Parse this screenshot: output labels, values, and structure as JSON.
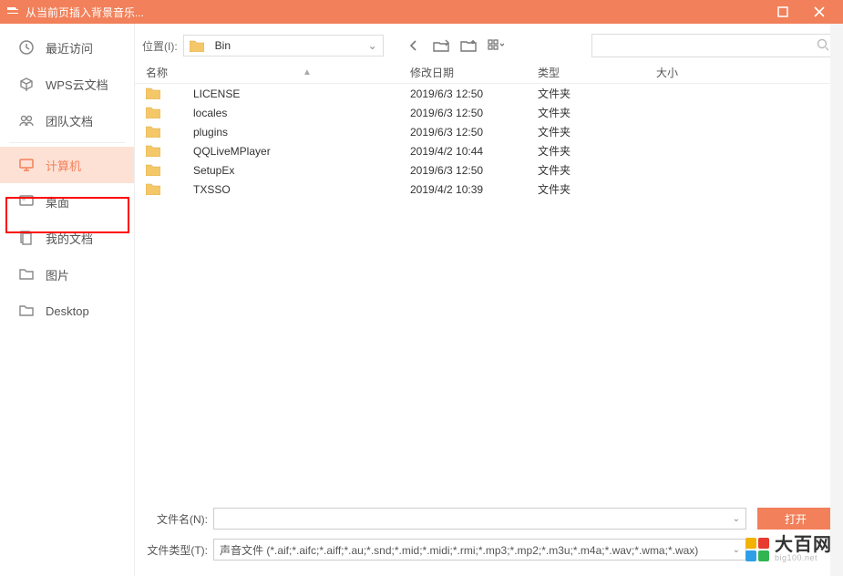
{
  "titlebar": {
    "title": "从当前页插入背景音乐..."
  },
  "sidebar": {
    "items": [
      {
        "label": "最近访问",
        "name": "recent"
      },
      {
        "label": "WPS云文档",
        "name": "wps-cloud"
      },
      {
        "label": "团队文档",
        "name": "team-docs"
      },
      {
        "label": "计算机",
        "name": "computer",
        "selected": true
      },
      {
        "label": "桌面",
        "name": "desktop-zh"
      },
      {
        "label": "我的文档",
        "name": "my-docs"
      },
      {
        "label": "图片",
        "name": "pictures"
      },
      {
        "label": "Desktop",
        "name": "desktop-en"
      }
    ]
  },
  "toolbar": {
    "location_label": "位置(I):",
    "location_value": "Bin"
  },
  "columns": {
    "name": "名称",
    "date": "修改日期",
    "type": "类型",
    "size": "大小"
  },
  "rows": [
    {
      "name": "LICENSE",
      "date": "2019/6/3 12:50",
      "type": "文件夹"
    },
    {
      "name": "locales",
      "date": "2019/6/3 12:50",
      "type": "文件夹"
    },
    {
      "name": "plugins",
      "date": "2019/6/3 12:50",
      "type": "文件夹"
    },
    {
      "name": "QQLiveMPlayer",
      "date": "2019/4/2 10:44",
      "type": "文件夹"
    },
    {
      "name": "SetupEx",
      "date": "2019/6/3 12:50",
      "type": "文件夹"
    },
    {
      "name": "TXSSO",
      "date": "2019/4/2 10:39",
      "type": "文件夹"
    }
  ],
  "bottom": {
    "filename_label": "文件名(N):",
    "filetype_label": "文件类型(T):",
    "filetype_value": "声音文件 (*.aif;*.aifc;*.aiff;*.au;*.snd;*.mid;*.midi;*.rmi;*.mp3;*.mp2;*.m3u;*.m4a;*.wav;*.wma;*.wax)",
    "open_label": "打开"
  },
  "watermark": {
    "zh": "大百网",
    "en": "big100.net"
  }
}
